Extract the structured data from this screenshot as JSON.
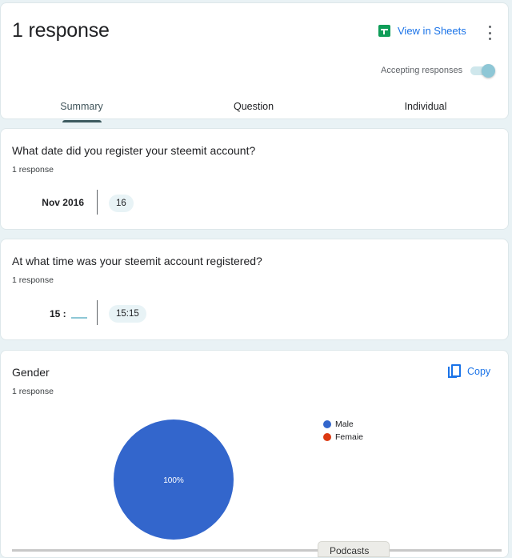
{
  "header": {
    "title": "1 response",
    "view_in_sheets": "View in Sheets",
    "accepting_label": "Accepting responses",
    "accepting_on": true,
    "tabs": [
      {
        "label": "Summary",
        "active": true
      },
      {
        "label": "Question",
        "active": false
      },
      {
        "label": "Individual",
        "active": false
      }
    ]
  },
  "questions": [
    {
      "title": "What date did you register your steemit account?",
      "count": "1 response",
      "group_label": "Nov 2016",
      "chip": "16"
    },
    {
      "title": "At what time was your steemit account registered?",
      "count": "1 response",
      "hour_label": "15 :",
      "chip": "15:15"
    },
    {
      "title": "Gender",
      "count": "1 response",
      "copy_label": "Copy"
    }
  ],
  "chart_data": {
    "type": "pie",
    "title": "Gender",
    "categories": [
      "Male",
      "Femaie"
    ],
    "values": [
      100,
      0
    ],
    "colors": [
      "#3366cc",
      "#dc3912"
    ],
    "slice_labels": [
      "100%"
    ],
    "legend_position": "right"
  },
  "overlay": {
    "partial_label": "Podcasts"
  }
}
